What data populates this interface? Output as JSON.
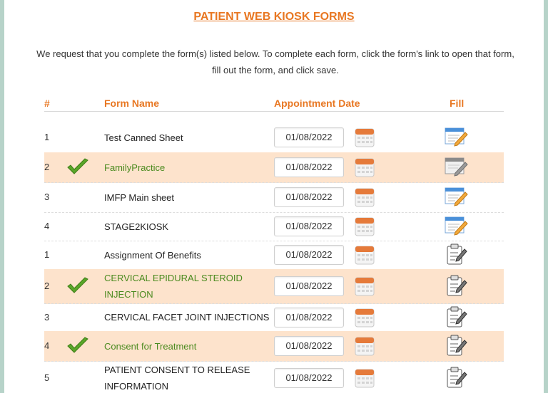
{
  "title": "PATIENT WEB KIOSK FORMS",
  "intro_line1": "We request that you complete the form(s) listed below. To complete each form, click the form's link to open that form,",
  "intro_line2": "fill out the form, and click save.",
  "columns": {
    "num": "#",
    "name": "Form Name",
    "date": "Appointment Date",
    "fill": "Fill"
  },
  "rows": [
    {
      "num": "1",
      "name": "Test Canned Sheet",
      "name2": "",
      "date": "01/08/2022",
      "completed": false,
      "fill_icon": "form-edit-icon"
    },
    {
      "num": "2",
      "name": "FamilyPractice",
      "name2": "",
      "date": "01/08/2022",
      "completed": true,
      "fill_icon": "form-edit-disabled-icon"
    },
    {
      "num": "3",
      "name": "IMFP Main sheet",
      "name2": "",
      "date": "01/08/2022",
      "completed": false,
      "fill_icon": "form-edit-icon"
    },
    {
      "num": "4",
      "name": "STAGE2KIOSK",
      "name2": "",
      "date": "01/08/2022",
      "completed": false,
      "fill_icon": "form-edit-icon"
    },
    {
      "num": "1",
      "name": "Assignment Of Benefits",
      "name2": "",
      "date": "01/08/2022",
      "completed": false,
      "fill_icon": "clipboard-edit-icon"
    },
    {
      "num": "2",
      "name": "CERVICAL EPIDURAL STEROID",
      "name2": "INJECTION",
      "date": "01/08/2022",
      "completed": true,
      "fill_icon": "clipboard-edit-icon"
    },
    {
      "num": "3",
      "name": "CERVICAL FACET JOINT INJECTIONS",
      "name2": "",
      "date": "01/08/2022",
      "completed": false,
      "fill_icon": "clipboard-edit-icon"
    },
    {
      "num": "4",
      "name": "Consent for Treatment",
      "name2": "",
      "date": "01/08/2022",
      "completed": true,
      "fill_icon": "clipboard-edit-icon"
    },
    {
      "num": "5",
      "name": "PATIENT CONSENT TO RELEASE",
      "name2": "INFORMATION",
      "date": "01/08/2022",
      "completed": false,
      "fill_icon": "clipboard-edit-icon"
    }
  ],
  "colors": {
    "accent": "#e87722",
    "highlight_row": "#fde3cc",
    "completed_text": "#4a8a1e",
    "check_green": "#5aa629"
  }
}
